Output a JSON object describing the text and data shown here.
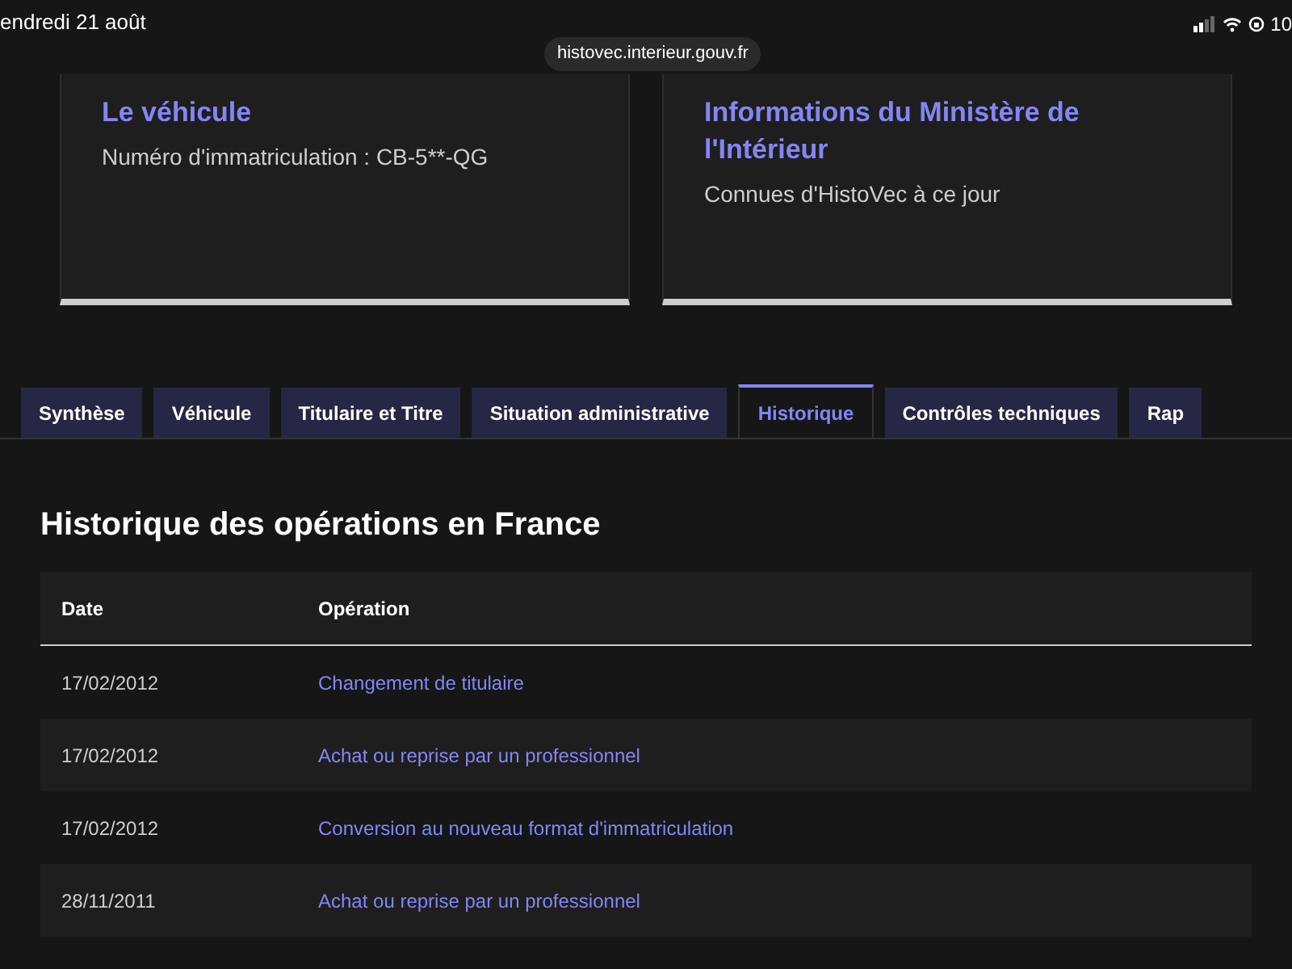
{
  "status_bar": {
    "date": "endredi 21 août",
    "url": "histovec.interieur.gouv.fr",
    "battery": "10"
  },
  "cards": [
    {
      "title": "Le véhicule",
      "text": "Numéro d'immatriculation : CB-5**-QG"
    },
    {
      "title": "Informations du Ministère de l'Intérieur",
      "text": "Connues d'HistoVec à ce jour"
    }
  ],
  "tabs": [
    {
      "label": "Synthèse",
      "selected": false
    },
    {
      "label": "Véhicule",
      "selected": false
    },
    {
      "label": "Titulaire et Titre",
      "selected": false
    },
    {
      "label": "Situation administrative",
      "selected": false
    },
    {
      "label": "Historique",
      "selected": true
    },
    {
      "label": "Contrôles techniques",
      "selected": false
    },
    {
      "label": "Rap",
      "selected": false
    }
  ],
  "section_title": "Historique des opérations en France",
  "table": {
    "columns": [
      "Date",
      "Opération"
    ],
    "rows": [
      [
        "17/02/2012",
        "Changement de titulaire"
      ],
      [
        "17/02/2012",
        "Achat ou reprise par un professionnel"
      ],
      [
        "17/02/2012",
        "Conversion au nouveau format d'immatriculation"
      ],
      [
        "28/11/2011",
        "Achat ou reprise par un professionnel"
      ]
    ]
  }
}
